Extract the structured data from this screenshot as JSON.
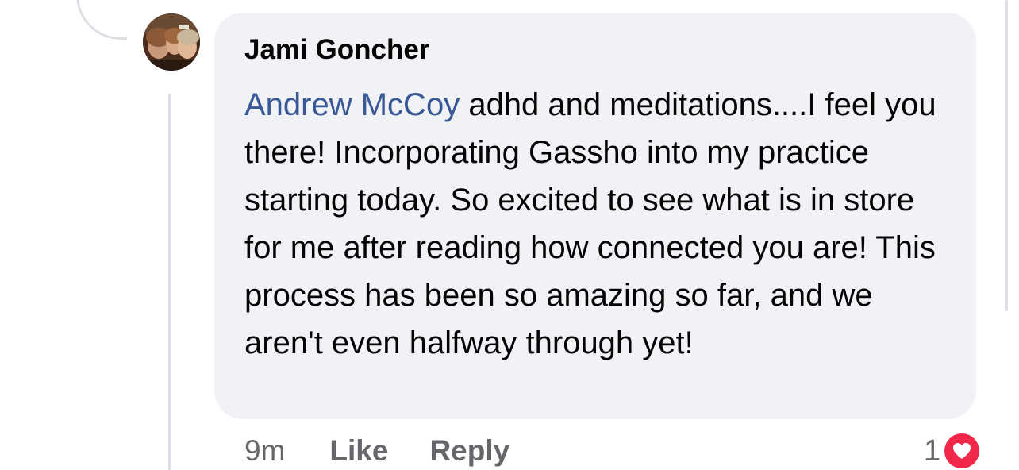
{
  "comment": {
    "author": "Jami Goncher",
    "mention": "Andrew McCoy",
    "text": " adhd and meditations....I feel you there! Incorporating Gassho into my practice starting today. So excited to see what is in store for me after reading how connected you are! This process has been so amazing so far, and we aren't even halfway through yet!",
    "avatar_icon": "profile-photo",
    "mention_color": "#385898",
    "bubble_color": "#f0f2f5"
  },
  "actions": {
    "timestamp": "9m",
    "like_label": "Like",
    "reply_label": "Reply"
  },
  "reactions": {
    "count": "1",
    "icon": "love-heart-icon",
    "color": "#f0284a"
  }
}
